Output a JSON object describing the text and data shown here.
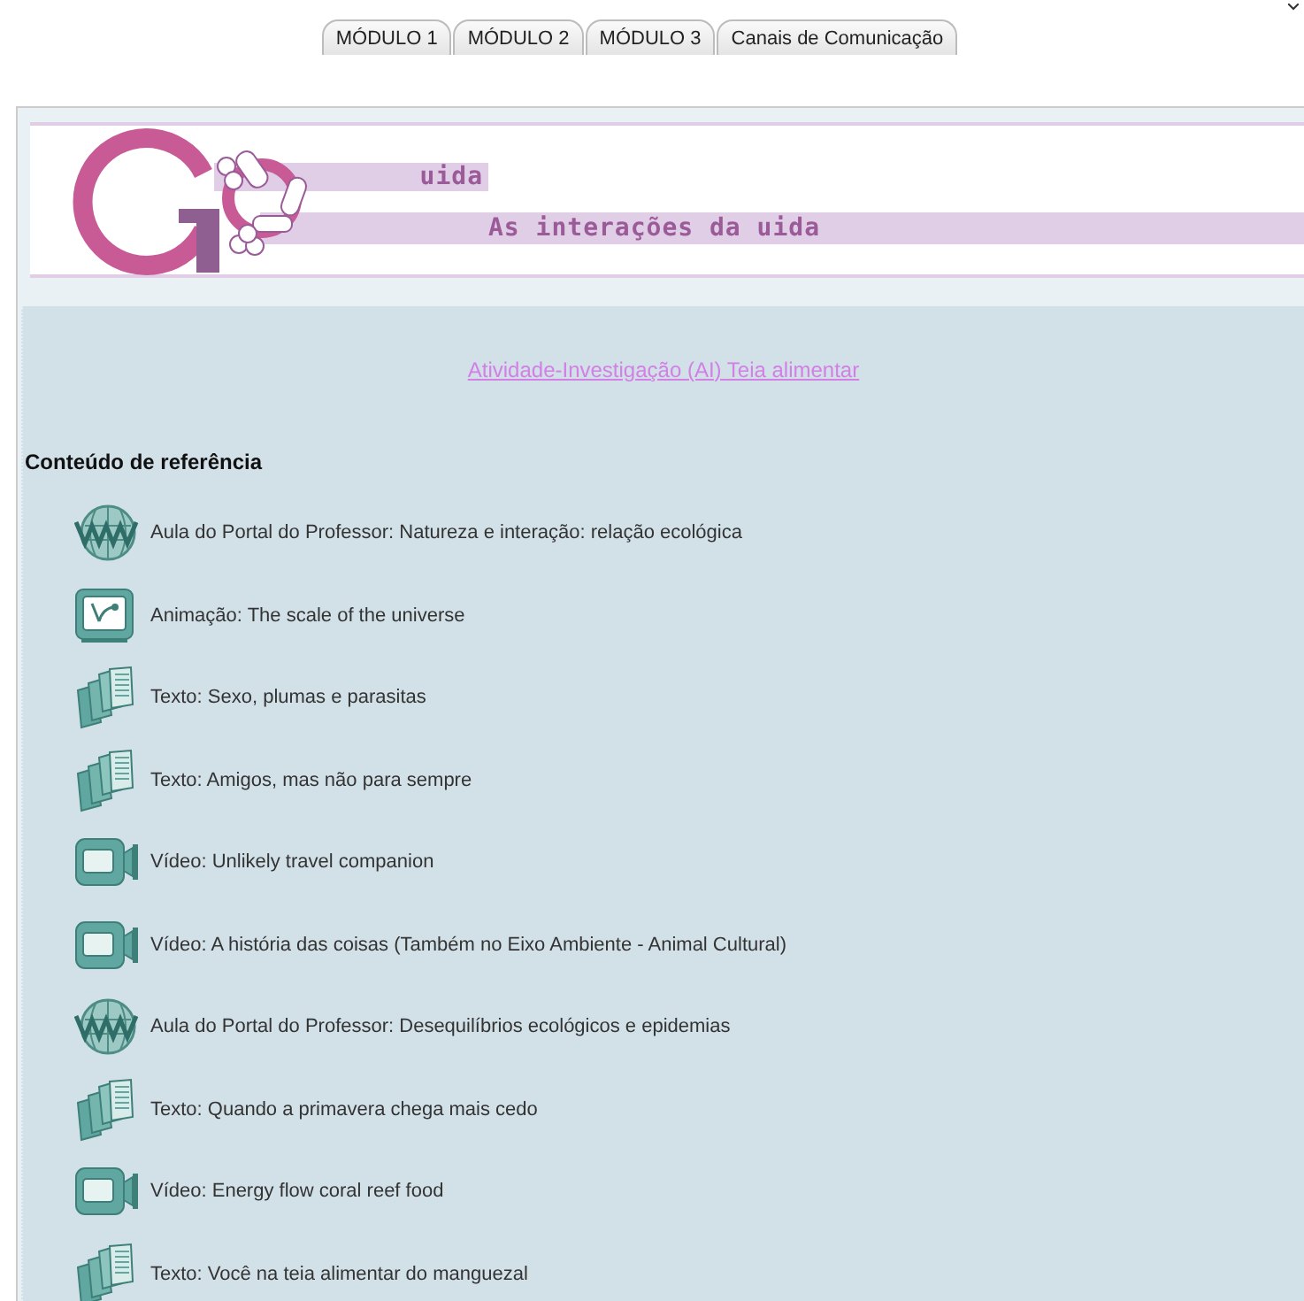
{
  "tabs": [
    {
      "label": "MÓDULO 1",
      "selected": false
    },
    {
      "label": "MÓDULO 2",
      "selected": false
    },
    {
      "label": "MÓDULO 3",
      "selected": false
    },
    {
      "label": "Canais de Comunicação",
      "selected": false
    }
  ],
  "banner": {
    "subtitle": "uida",
    "title": "As interações da uida"
  },
  "activity_link": "Atividade-Investigação (AI) Teia alimentar",
  "section_title": "Conteúdo de referência",
  "items": [
    {
      "kind": "web",
      "label": "Aula do Portal do Professor: Natureza e interação: relação ecológica"
    },
    {
      "kind": "animation",
      "label": "Animação: The scale of the universe"
    },
    {
      "kind": "text",
      "label": "Texto: Sexo, plumas e parasitas"
    },
    {
      "kind": "text",
      "label": "Texto: Amigos, mas não para sempre"
    },
    {
      "kind": "video",
      "label": "Vídeo: Unlikely travel companion"
    },
    {
      "kind": "video",
      "label": "Vídeo: A história das coisas (Também no Eixo Ambiente - Animal Cultural)"
    },
    {
      "kind": "web",
      "label": "Aula do Portal do Professor: Desequilíbrios ecológicos e epidemias"
    },
    {
      "kind": "text",
      "label": "Texto: Quando a primavera chega mais cedo"
    },
    {
      "kind": "video",
      "label": "Vídeo: Energy flow coral reef food"
    },
    {
      "kind": "text",
      "label": "Texto: Você na teia alimentar do manguezal"
    }
  ]
}
